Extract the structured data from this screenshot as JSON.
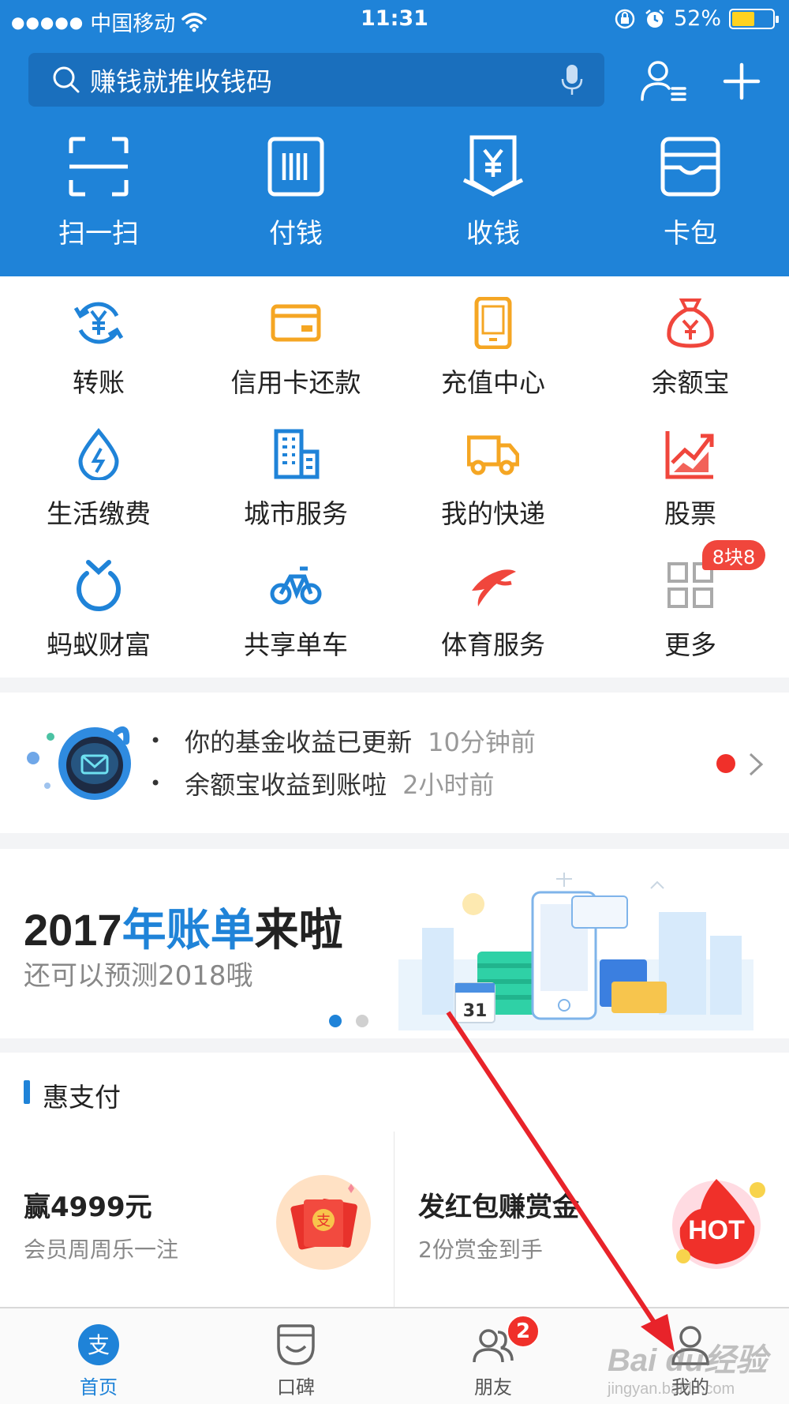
{
  "status_bar": {
    "carrier": "中国移动",
    "time": "11:31",
    "battery_percent": "52%",
    "battery_level": 0.52
  },
  "search": {
    "placeholder": "赚钱就推收钱码"
  },
  "top_actions": [
    {
      "label": "扫一扫",
      "icon": "scan-icon"
    },
    {
      "label": "付钱",
      "icon": "barcode-pay-icon"
    },
    {
      "label": "收钱",
      "icon": "yuan-receive-icon"
    },
    {
      "label": "卡包",
      "icon": "card-wallet-icon"
    }
  ],
  "grid": [
    {
      "label": "转账",
      "icon": "transfer-icon",
      "color": "#1f83d8"
    },
    {
      "label": "信用卡还款",
      "icon": "credit-card-icon",
      "color": "#f5a623"
    },
    {
      "label": "充值中心",
      "icon": "phone-recharge-icon",
      "color": "#f5a623"
    },
    {
      "label": "余额宝",
      "icon": "money-bag-icon",
      "color": "#f0463c"
    },
    {
      "label": "生活缴费",
      "icon": "utility-bill-icon",
      "color": "#1f83d8"
    },
    {
      "label": "城市服务",
      "icon": "city-building-icon",
      "color": "#1f83d8"
    },
    {
      "label": "我的快递",
      "icon": "delivery-truck-icon",
      "color": "#f5a623"
    },
    {
      "label": "股票",
      "icon": "stock-chart-icon",
      "color": "#f0463c"
    },
    {
      "label": "蚂蚁财富",
      "icon": "ant-fortune-icon",
      "color": "#1f83d8"
    },
    {
      "label": "共享单车",
      "icon": "bicycle-icon",
      "color": "#1f83d8"
    },
    {
      "label": "体育服务",
      "icon": "sports-icon",
      "color": "#f0463c"
    },
    {
      "label": "更多",
      "icon": "more-grid-icon",
      "color": "#999999"
    }
  ],
  "more_badge": "8块8",
  "notice": {
    "items": [
      {
        "text": "你的基金收益已更新",
        "time": "10分钟前"
      },
      {
        "text": "余额宝收益到账啦",
        "time": "2小时前"
      }
    ]
  },
  "banner": {
    "title_year": "2017",
    "title_highlight": "年账单",
    "title_end": "来啦",
    "subtitle": "还可以预测2018哦",
    "calendar_day": "31"
  },
  "hui": {
    "title": "惠支付",
    "promos": [
      {
        "title": "赢4999元",
        "subtitle": "会员周周乐一注",
        "icon": "red-envelope-icon"
      },
      {
        "title": "发红包赚赏金",
        "subtitle": "2份赏金到手",
        "icon": "hot-badge-icon",
        "icon_text": "HOT"
      }
    ]
  },
  "tabbar": {
    "tabs": [
      {
        "label": "首页",
        "icon": "alipay-home-icon",
        "active": true
      },
      {
        "label": "口碑",
        "icon": "koubei-icon"
      },
      {
        "label": "朋友",
        "icon": "friends-icon",
        "badge": "2"
      },
      {
        "label": "我的",
        "icon": "profile-icon"
      }
    ]
  },
  "watermark": {
    "brand": "Bai du经验",
    "url": "jingyan.baidu.com"
  },
  "colors": {
    "brand_blue": "#1f83d8",
    "search_bg": "#1a6fbd",
    "badge_red": "#f0302a"
  }
}
